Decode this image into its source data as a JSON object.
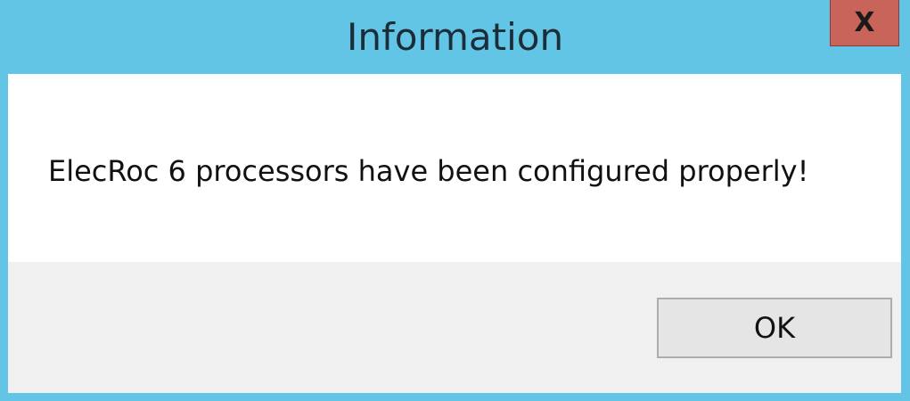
{
  "window": {
    "title": "Information",
    "close_label": "X",
    "accent_color": "#63c5e6",
    "close_color": "#c9645a"
  },
  "message": {
    "text": "ElecRoc 6 processors have been configured properly!"
  },
  "buttons": {
    "ok_label": "OK"
  }
}
